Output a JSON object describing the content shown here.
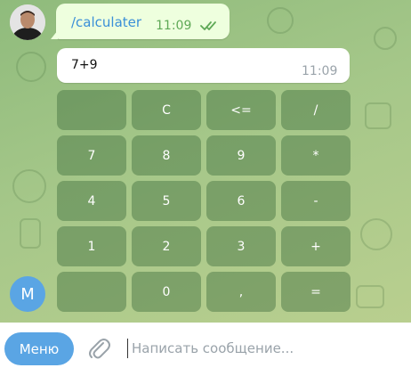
{
  "messages": {
    "outgoing": {
      "text": "/calculater",
      "time": "11:09"
    },
    "incoming": {
      "text": "7+9",
      "time": "11:09"
    }
  },
  "keyboard": {
    "rows": [
      [
        "",
        "C",
        "<=",
        "/"
      ],
      [
        "7",
        "8",
        "9",
        "*"
      ],
      [
        "4",
        "5",
        "6",
        "-"
      ],
      [
        "1",
        "2",
        "3",
        "+"
      ],
      [
        "",
        "0",
        ",",
        "="
      ]
    ]
  },
  "user": {
    "initial": "M"
  },
  "compose": {
    "menu_label": "Меню",
    "placeholder": "Написать сообщение..."
  },
  "colors": {
    "accent": "#5aa5e4",
    "outgoing_bubble": "#eeffde",
    "check": "#5fa957",
    "key_bg": "rgba(64,110,62,0.45)"
  },
  "icons": [
    "double-check-icon",
    "paperclip-icon"
  ]
}
